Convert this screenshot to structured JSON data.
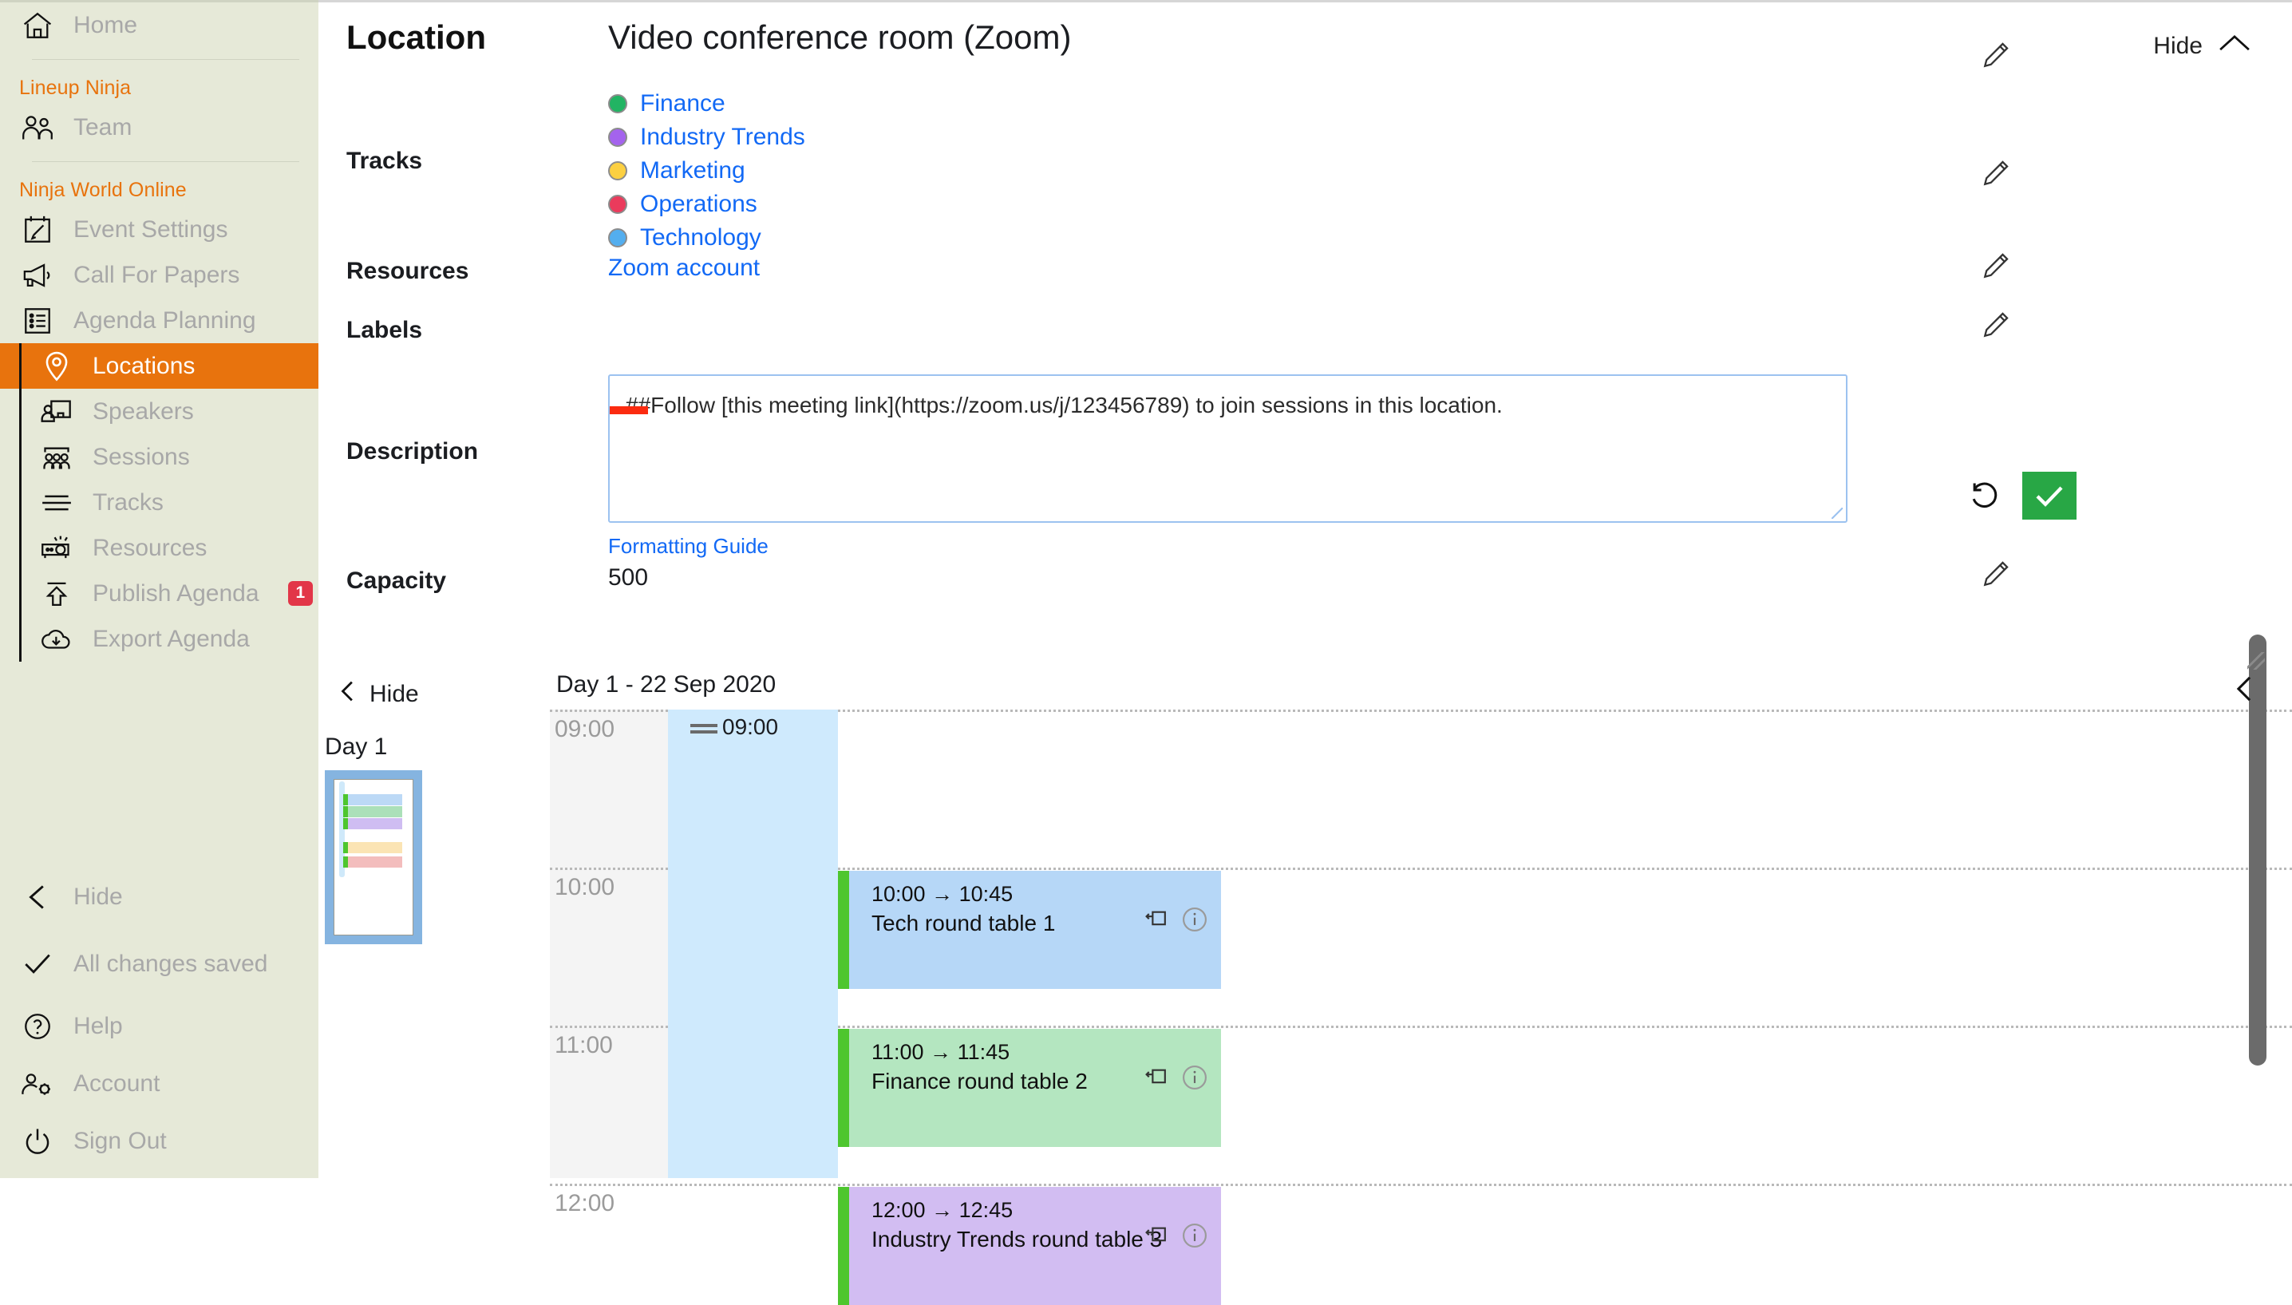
{
  "sidebar": {
    "home": {
      "label": "Home",
      "icon": "home-icon"
    },
    "groups": [
      {
        "title": "Lineup Ninja",
        "items": [
          {
            "label": "Team",
            "icon": "team-icon"
          }
        ]
      },
      {
        "title": "Ninja World Online",
        "items": [
          {
            "label": "Event Settings",
            "icon": "calendar-edit-icon"
          },
          {
            "label": "Call For Papers",
            "icon": "megaphone-icon"
          },
          {
            "label": "Agenda Planning",
            "icon": "list-icon"
          }
        ],
        "sub_items": [
          {
            "label": "Locations",
            "icon": "map-pin-icon",
            "active": true
          },
          {
            "label": "Speakers",
            "icon": "speaker-presenter-icon",
            "active": false
          },
          {
            "label": "Sessions",
            "icon": "audience-icon",
            "active": false
          },
          {
            "label": "Tracks",
            "icon": "lines-icon",
            "active": false
          },
          {
            "label": "Resources",
            "icon": "projector-icon",
            "active": false
          },
          {
            "label": "Publish Agenda",
            "icon": "upload-icon",
            "active": false,
            "badge": "1"
          },
          {
            "label": "Export Agenda",
            "icon": "cloud-download-icon",
            "active": false
          }
        ]
      }
    ],
    "bottom": [
      {
        "label": "Hide",
        "icon": "chevron-left-icon"
      },
      {
        "label": "All changes saved",
        "icon": "check-icon"
      },
      {
        "label": "Help",
        "icon": "question-circle-icon"
      },
      {
        "label": "Account",
        "icon": "account-gear-icon"
      },
      {
        "label": "Sign Out",
        "icon": "power-icon"
      }
    ]
  },
  "header": {
    "page_title": "Location",
    "location_name": "Video conference room (Zoom)",
    "hide_label": "Hide"
  },
  "details": {
    "tracks_label": "Tracks",
    "tracks": [
      {
        "name": "Finance",
        "color": "#22b463"
      },
      {
        "name": "Industry Trends",
        "color": "#a463ed"
      },
      {
        "name": "Marketing",
        "color": "#fcd041"
      },
      {
        "name": "Operations",
        "color": "#ea3b5c"
      },
      {
        "name": "Technology",
        "color": "#53aeef"
      }
    ],
    "resources_label": "Resources",
    "resources": [
      "Zoom account"
    ],
    "labels_label": "Labels",
    "labels": [],
    "description_label": "Description",
    "description_value": "##Follow [this meeting link](https://zoom.us/j/123456789) to join sessions in this location.",
    "description_placeholder": "",
    "formatting_guide_label": "Formatting Guide",
    "capacity_label": "Capacity",
    "capacity_value": "500",
    "edit_icon": "pencil-icon",
    "undo_icon": "undo-icon",
    "confirm_icon": "check-icon"
  },
  "agenda": {
    "hide_label": "Hide",
    "day_label": "Day 1",
    "calendar_title": "Day 1 - 22 Sep 2020",
    "current_time_marker": "09:00",
    "hours": [
      "09:00",
      "10:00",
      "11:00",
      "12:00"
    ],
    "thumbnail_bars": [
      {
        "color": "#bcd9f6"
      },
      {
        "color": "#abe0b9"
      },
      {
        "color": "#cfbdf2"
      },
      {
        "color": "#fbe4b4"
      },
      {
        "color": "#f3bdbd"
      }
    ],
    "events": [
      {
        "time": "10:00 → 10:45",
        "title": "Tech round table 1",
        "color": "#b6d7f7",
        "stripe": "#4ec62e",
        "pin_icon": "pin-icon",
        "info_icon": "info-icon"
      },
      {
        "time": "11:00 → 11:45",
        "title": "Finance round table 2",
        "color": "#b4e6c0",
        "stripe": "#4ec62e",
        "pin_icon": "pin-icon",
        "info_icon": "info-icon"
      },
      {
        "time": "12:00 → 12:45",
        "title": "Industry Trends round table 3",
        "color": "#d2bdf2",
        "stripe": "#4ec62e",
        "pin_icon": "pin-icon",
        "info_icon": "info-icon"
      }
    ]
  },
  "colors": {
    "sidebar_bg": "#e6e9d8",
    "accent_orange": "#e8730d",
    "link_blue": "#1269f5",
    "save_green": "#28a745",
    "badge_red": "#e23648",
    "now_column": "#cfeafd"
  }
}
